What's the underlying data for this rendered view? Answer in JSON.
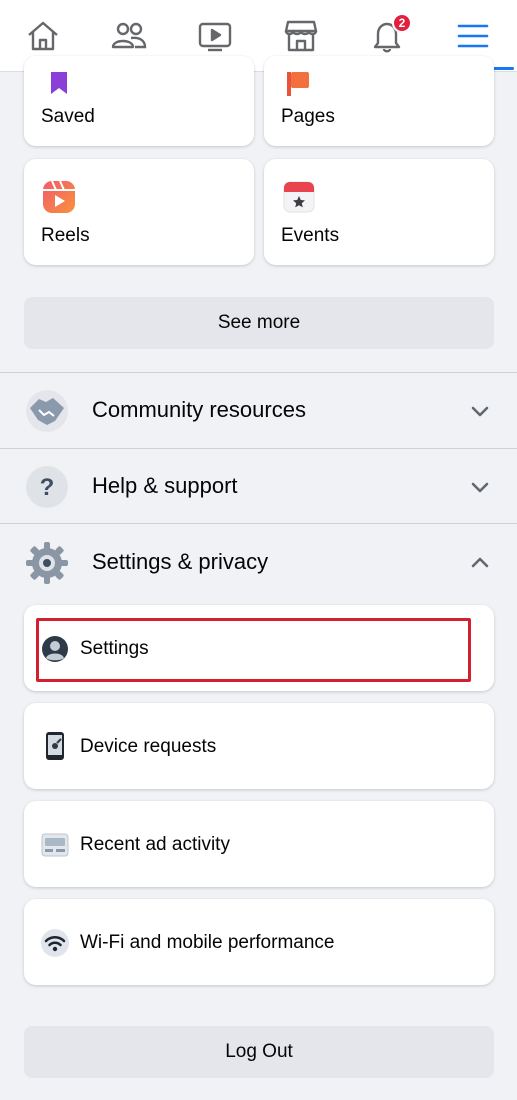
{
  "nav": {
    "tabs": [
      {
        "name": "home",
        "icon": "home-icon"
      },
      {
        "name": "friends",
        "icon": "friends-icon"
      },
      {
        "name": "watch",
        "icon": "video-icon"
      },
      {
        "name": "marketplace",
        "icon": "marketplace-icon"
      },
      {
        "name": "notifications",
        "icon": "bell-icon",
        "badge": "2"
      },
      {
        "name": "menu",
        "icon": "hamburger-icon",
        "active": true
      }
    ],
    "active_color": "#1877f2"
  },
  "shortcuts": {
    "saved_label": "Saved",
    "pages_label": "Pages",
    "reels_label": "Reels",
    "events_label": "Events",
    "see_more_label": "See more"
  },
  "sections": {
    "community_label": "Community resources",
    "help_label": "Help & support",
    "settings_privacy_label": "Settings & privacy"
  },
  "settings_items": {
    "settings_label": "Settings",
    "device_requests_label": "Device requests",
    "recent_ad_activity_label": "Recent ad activity",
    "wifi_label": "Wi-Fi and mobile performance"
  },
  "logout_label": "Log Out",
  "highlight_color": "#d32030"
}
